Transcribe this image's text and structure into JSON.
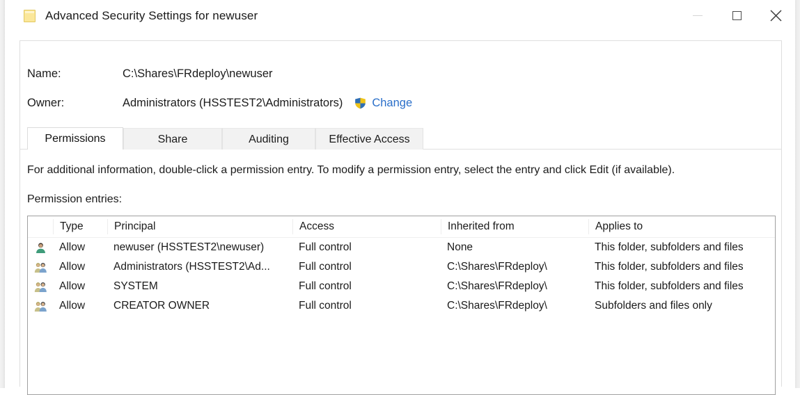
{
  "window": {
    "title": "Advanced Security Settings for newuser",
    "icon": "folder-icon",
    "controls": {
      "minimize": "minimize-icon",
      "maximize": "maximize-icon",
      "close": "close-icon"
    }
  },
  "info": {
    "name_label": "Name:",
    "name_value": "C:\\Shares\\FRdeploy\\newuser",
    "owner_label": "Owner:",
    "owner_value": "Administrators (HSSTEST2\\Administrators)",
    "change_link": "Change",
    "shield_icon": "uac-shield-icon"
  },
  "tabs": [
    {
      "label": "Permissions",
      "active": true
    },
    {
      "label": "Share",
      "active": false
    },
    {
      "label": "Auditing",
      "active": false
    },
    {
      "label": "Effective Access",
      "active": false
    }
  ],
  "main": {
    "instruction": "For additional information, double-click a permission entry. To modify a permission entry, select the entry and click Edit (if available).",
    "entries_label": "Permission entries:"
  },
  "table": {
    "columns": [
      "",
      "Type",
      "Principal",
      "Access",
      "Inherited from",
      "Applies to"
    ],
    "rows": [
      {
        "icon": "user-icon",
        "type": "Allow",
        "principal": "newuser (HSSTEST2\\newuser)",
        "access": "Full control",
        "inherited_from": "None",
        "applies_to": "This folder, subfolders and files"
      },
      {
        "icon": "group-icon",
        "type": "Allow",
        "principal": "Administrators (HSSTEST2\\Ad...",
        "access": "Full control",
        "inherited_from": "C:\\Shares\\FRdeploy\\",
        "applies_to": "This folder, subfolders and files"
      },
      {
        "icon": "group-icon",
        "type": "Allow",
        "principal": "SYSTEM",
        "access": "Full control",
        "inherited_from": "C:\\Shares\\FRdeploy\\",
        "applies_to": "This folder, subfolders and files"
      },
      {
        "icon": "group-icon",
        "type": "Allow",
        "principal": "CREATOR OWNER",
        "access": "Full control",
        "inherited_from": "C:\\Shares\\FRdeploy\\",
        "applies_to": "Subfolders and files only"
      }
    ]
  },
  "colors": {
    "link": "#2a6fc9",
    "folder": "#fbe79a",
    "text": "#1b1b1b",
    "tab_inactive_bg": "#f2f2f2",
    "listbox_border": "#a0a0a0"
  }
}
